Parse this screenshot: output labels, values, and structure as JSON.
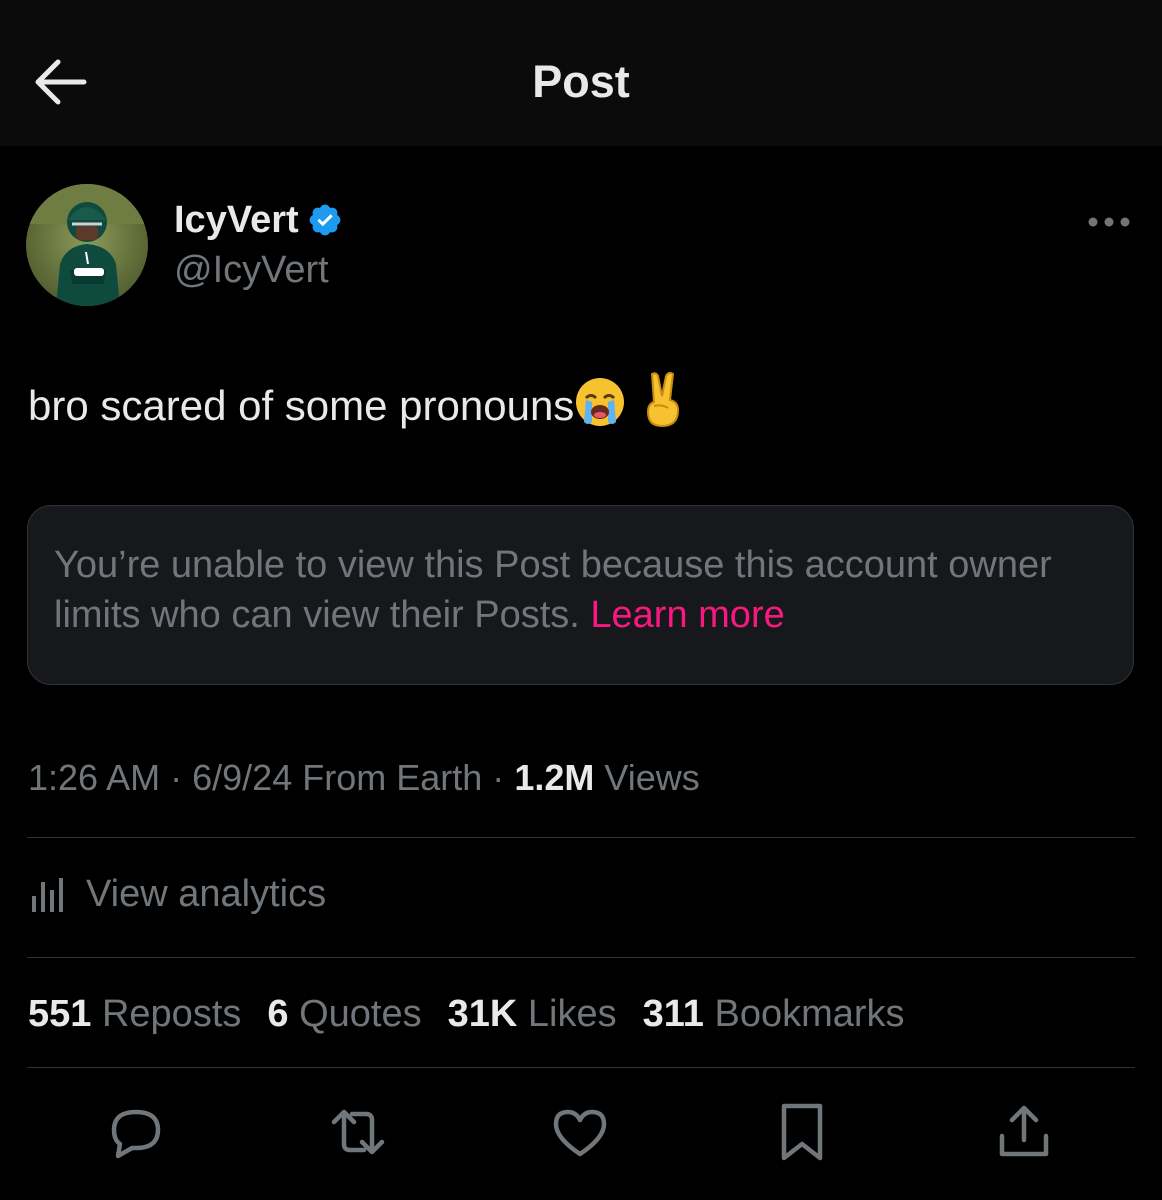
{
  "header": {
    "title": "Post"
  },
  "author": {
    "display_name": "IcyVert",
    "handle": "@IcyVert",
    "verified_color": "#1d9bf0"
  },
  "post": {
    "text": "bro scared of some pronouns",
    "emojis": [
      "loudly-crying-face",
      "victory-hand"
    ]
  },
  "quoted_notice": {
    "text": "You’re unable to view this Post because this account owner limits who can view their Posts.",
    "link": "Learn more",
    "link_color": "#f91880"
  },
  "meta": {
    "time": "1:26 AM",
    "date": "6/9/24",
    "source": "From Earth",
    "views_count": "1.2M",
    "views_label": "Views"
  },
  "analytics": {
    "label": "View analytics"
  },
  "stats": [
    {
      "count": "551",
      "label": "Reposts"
    },
    {
      "count": "6",
      "label": "Quotes"
    },
    {
      "count": "31K",
      "label": "Likes"
    },
    {
      "count": "311",
      "label": "Bookmarks"
    }
  ],
  "actions": [
    "reply-icon",
    "repost-icon",
    "like-icon",
    "bookmark-icon",
    "share-icon"
  ]
}
